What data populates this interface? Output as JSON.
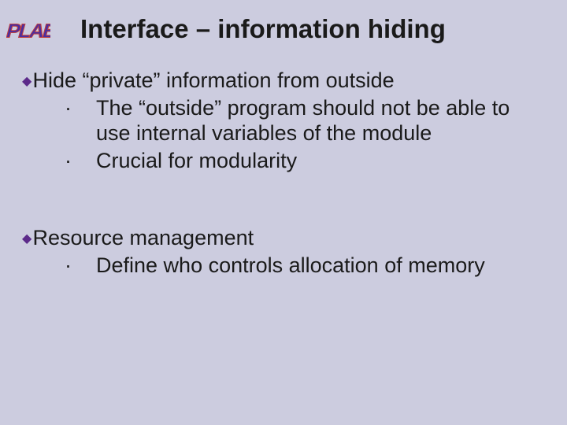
{
  "logo": {
    "alt": "PLAB",
    "fill": "#4a2ea0",
    "outline": "#c04040"
  },
  "title": "Interface – information hiding",
  "bullets": [
    {
      "text": "Hide “private” information from outside",
      "sub": [
        "The “outside” program should not be able to use internal variables of the module",
        "Crucial for modularity"
      ]
    },
    {
      "text": "Resource management",
      "sub": [
        "Define who controls allocation of memory"
      ]
    }
  ]
}
